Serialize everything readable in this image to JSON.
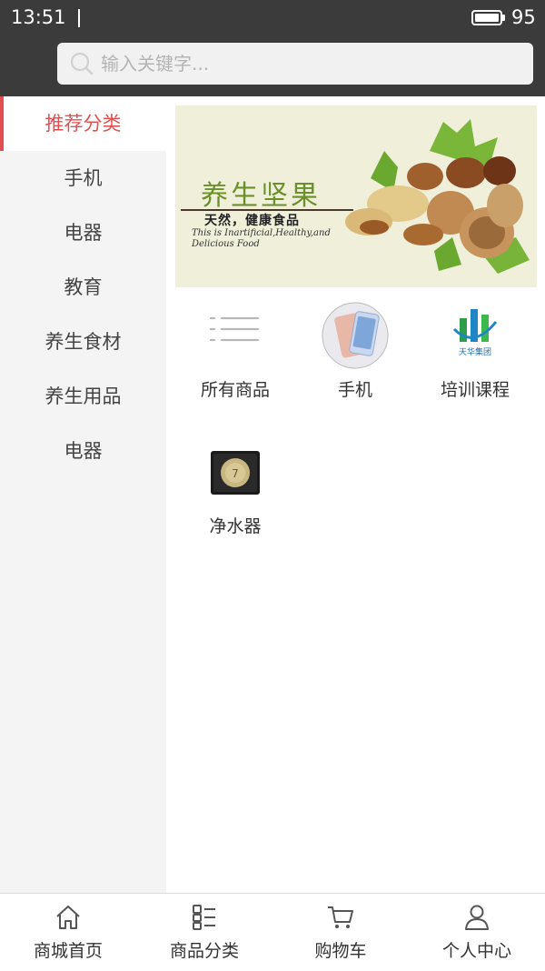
{
  "status": {
    "time": "13:51",
    "battery": "95"
  },
  "search": {
    "placeholder": "输入关键字..."
  },
  "sidebar": {
    "items": [
      {
        "label": "推荐分类",
        "active": true
      },
      {
        "label": "手机"
      },
      {
        "label": "电器"
      },
      {
        "label": "教育"
      },
      {
        "label": "养生食材"
      },
      {
        "label": "养生用品"
      },
      {
        "label": "电器"
      }
    ]
  },
  "banner": {
    "title": "养生坚果",
    "subtitle": "天然，健康食品",
    "english": "This is Inartificial,Healthy,and Delicious Food"
  },
  "categories": [
    {
      "label": "所有商品",
      "icon": "list-lines-icon"
    },
    {
      "label": "手机",
      "icon": "phone-product-icon"
    },
    {
      "label": "培训课程",
      "icon": "tianhua-logo-icon",
      "logo_text": "天华集团"
    },
    {
      "label": "净水器",
      "icon": "water-purifier-icon"
    }
  ],
  "tabbar": {
    "items": [
      {
        "label": "商城首页",
        "icon": "home-icon"
      },
      {
        "label": "商品分类",
        "icon": "category-icon"
      },
      {
        "label": "购物车",
        "icon": "cart-icon"
      },
      {
        "label": "个人中心",
        "icon": "user-icon"
      }
    ]
  },
  "colors": {
    "accent": "#e05050",
    "header": "#3b3b3b",
    "sidebar_bg": "#f4f4f4"
  }
}
